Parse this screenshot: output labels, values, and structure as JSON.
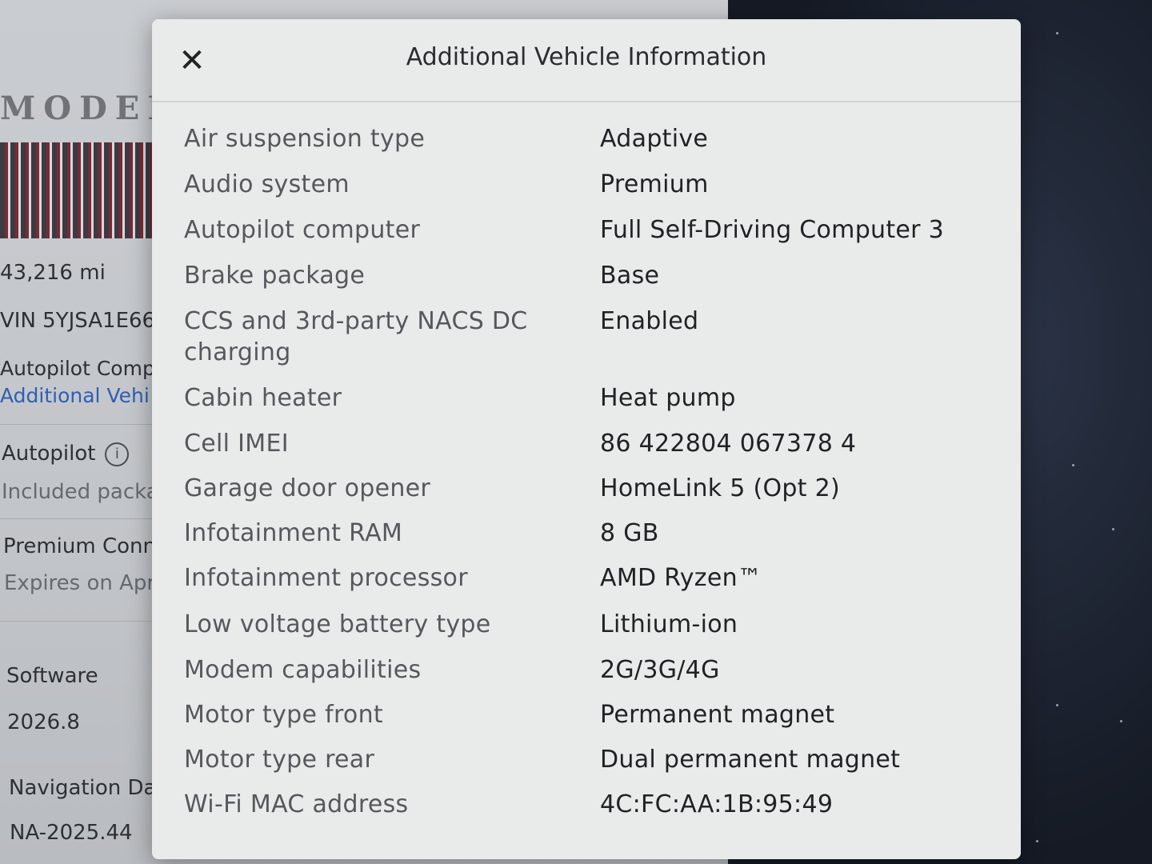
{
  "background": {
    "model_logo": "MODEL",
    "odometer": "43,216 mi",
    "vin": "VIN 5YJSA1E66",
    "autopilot_computer_label": "Autopilot Comp",
    "additional_vehicle_link": "Additional Vehi",
    "autopilot_label": "Autopilot",
    "included_package": "Included packa",
    "premium_connectivity_label": "Premium Conn",
    "premium_connectivity_expiry": "Expires on Apr",
    "software_label": "Software",
    "software_version": "2026.8",
    "navigation_data_label": "Navigation Data",
    "navigation_data_version": "NA-2025.44"
  },
  "modal": {
    "title": "Additional Vehicle Information",
    "close_icon": "close-icon",
    "rows": [
      {
        "label": "Air suspension type",
        "value": "Adaptive"
      },
      {
        "label": "Audio system",
        "value": "Premium"
      },
      {
        "label": "Autopilot computer",
        "value": "Full Self-Driving Computer 3"
      },
      {
        "label": "Brake package",
        "value": "Base"
      },
      {
        "label": "CCS and 3rd-party NACS DC charging",
        "value": "Enabled"
      },
      {
        "label": "Cabin heater",
        "value": "Heat pump"
      },
      {
        "label": "Cell IMEI",
        "value": "86 422804 067378 4"
      },
      {
        "label": "Garage door opener",
        "value": "HomeLink 5 (Opt 2)"
      },
      {
        "label": "Infotainment RAM",
        "value": "8 GB"
      },
      {
        "label": "Infotainment processor",
        "value": "AMD Ryzen™"
      },
      {
        "label": "Low voltage battery type",
        "value": "Lithium-ion"
      },
      {
        "label": "Modem capabilities",
        "value": "2G/3G/4G"
      },
      {
        "label": "Motor type front",
        "value": "Permanent magnet"
      },
      {
        "label": "Motor type rear",
        "value": "Dual permanent magnet"
      },
      {
        "label": "Wi-Fi MAC address",
        "value": "4C:FC:AA:1B:95:49"
      }
    ]
  }
}
